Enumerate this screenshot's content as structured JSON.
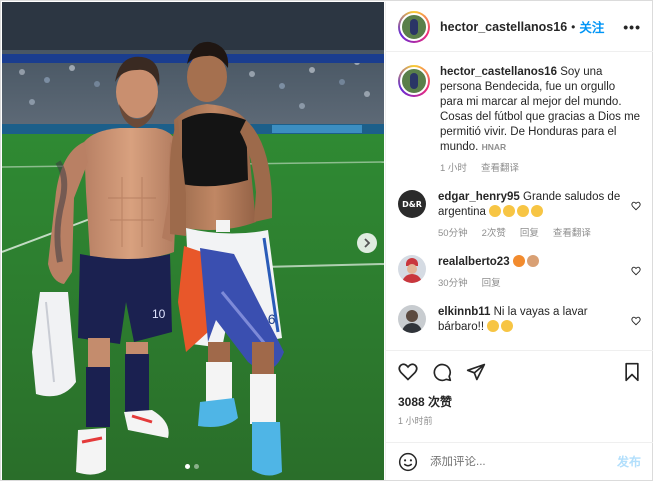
{
  "post": {
    "username": "hector_castellanos16",
    "follow_separator": "•",
    "follow_label": "关注",
    "more_label": "•••"
  },
  "caption": {
    "username": "hector_castellanos16",
    "text": "Soy una persona Bendecida, fue un orgullo para mi marcar al mejor del mundo. Cosas del fútbol que gracias a Dios me permitió vivir. De Honduras para el mundo.",
    "tag": "HNAR",
    "time": "1 小时",
    "translate_label": "查看翻译"
  },
  "comments": [
    {
      "username": "edgar_henry95",
      "text": "Grande saludos de argentina",
      "emoji_count": 4,
      "emoji_colors": [
        "#f7c544",
        "#f7c544",
        "#f7c544",
        "#f7c544"
      ],
      "time": "50分钟",
      "likes": "2次赞",
      "reply_label": "回复",
      "translate_label": "查看翻译"
    },
    {
      "username": "realalberto23",
      "text": "",
      "emoji_count": 2,
      "emoji_colors": [
        "#f28b2e",
        "#d9a074"
      ],
      "time": "30分钟",
      "reply_label": "回复"
    },
    {
      "username": "elkinnb11",
      "text": "Ni la vayas a lavar bárbaro!!",
      "emoji_count": 2,
      "emoji_colors": [
        "#f7c544",
        "#f7c544"
      ]
    }
  ],
  "actions": {
    "likes": "3088 次赞",
    "time": "1 小时前"
  },
  "comment_box": {
    "placeholder": "添加评论...",
    "post_label": "发布"
  },
  "colors": {
    "link_blue": "#0095f6",
    "post_disabled": "#b2dffc",
    "meta_gray": "#8e8e8e"
  },
  "carousel": {
    "dot_count": 2,
    "active_index": 0
  }
}
